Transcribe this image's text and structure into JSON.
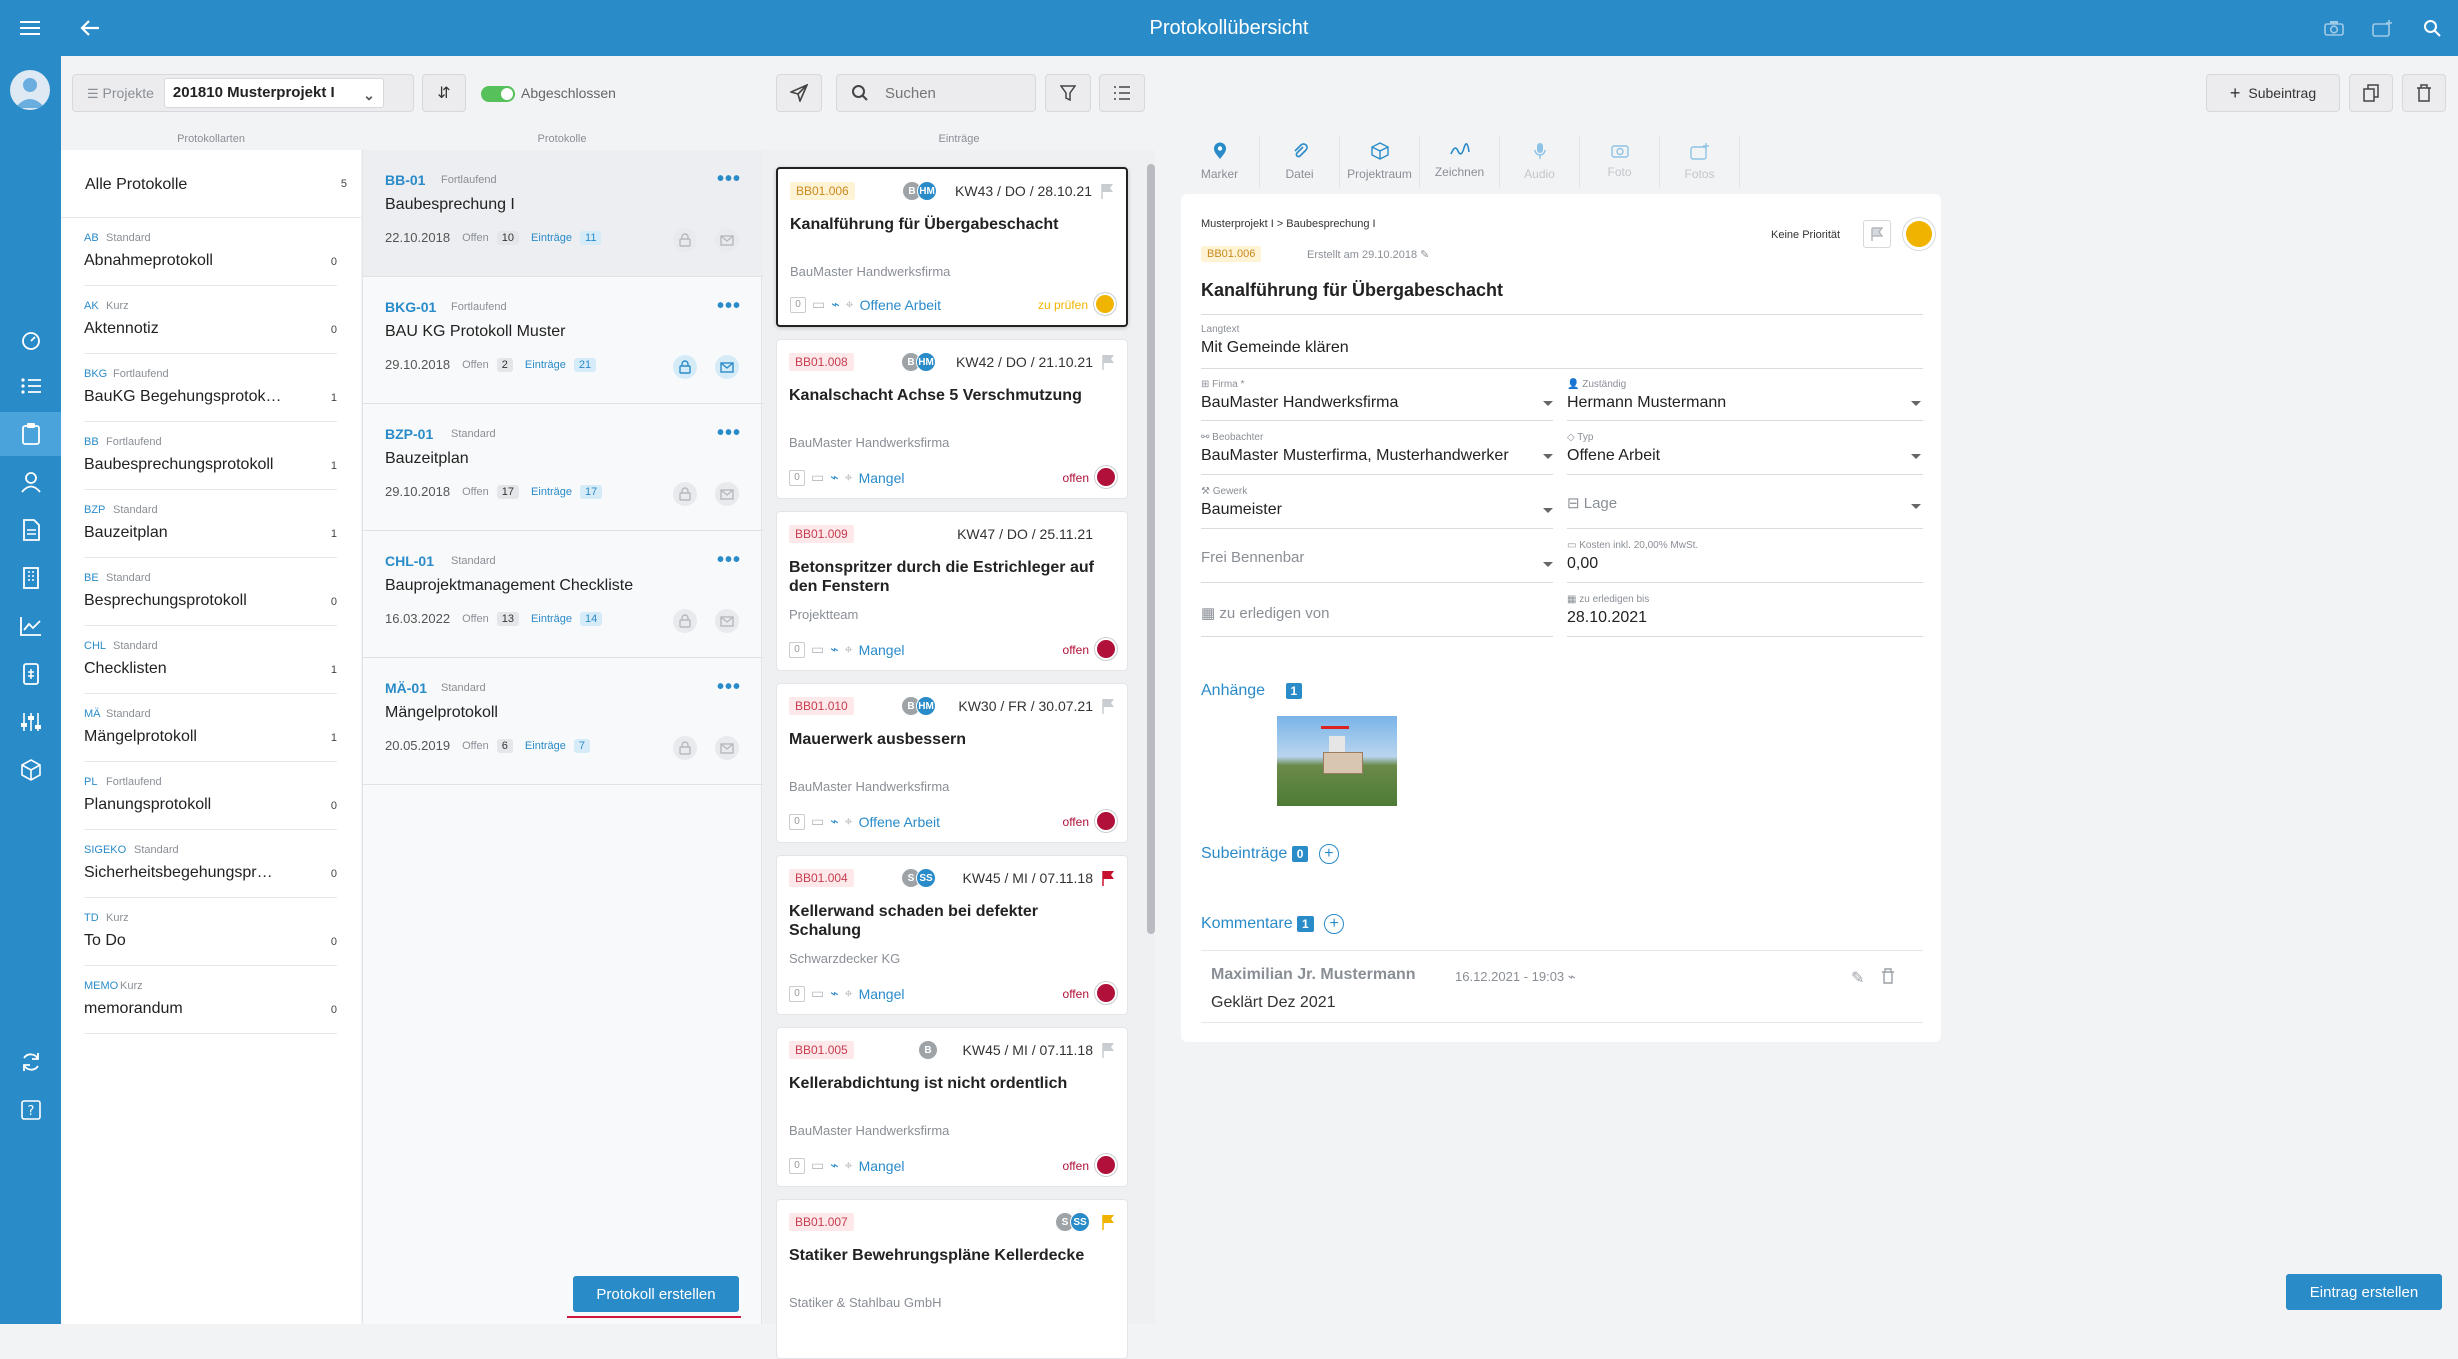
{
  "app": {
    "title": "Protokollübersicht"
  },
  "toolbar": {
    "projects_label": "Projekte",
    "project_value": "201810 Musterprojekt I",
    "toggle_label": "Abgeschlossen",
    "search_placeholder": "Suchen",
    "subentry_label": "Subeintrag"
  },
  "columns": {
    "col1": "Protokollarten",
    "col2": "Protokolle",
    "col3": "Einträge"
  },
  "categories_all": {
    "label": "Alle Protokolle",
    "count": "5"
  },
  "categories": [
    {
      "abbr": "AB",
      "type": "Standard",
      "name": "Abnahmeprotokoll",
      "count": "0"
    },
    {
      "abbr": "AK",
      "type": "Kurz",
      "name": "Aktennotiz",
      "count": "0"
    },
    {
      "abbr": "BKG",
      "type": "Fortlaufend",
      "name": "BauKG Begehungsprotok…",
      "count": "1"
    },
    {
      "abbr": "BB",
      "type": "Fortlaufend",
      "name": "Baubesprechungsprotokoll",
      "count": "1"
    },
    {
      "abbr": "BZP",
      "type": "Standard",
      "name": "Bauzeitplan",
      "count": "1"
    },
    {
      "abbr": "BE",
      "type": "Standard",
      "name": "Besprechungsprotokoll",
      "count": "0"
    },
    {
      "abbr": "CHL",
      "type": "Standard",
      "name": "Checklisten",
      "count": "1"
    },
    {
      "abbr": "MÄ",
      "type": "Standard",
      "name": "Mängelprotokoll",
      "count": "1"
    },
    {
      "abbr": "PL",
      "type": "Fortlaufend",
      "name": "Planungsprotokoll",
      "count": "0"
    },
    {
      "abbr": "SIGEKO",
      "type": "Standard",
      "name": "Sicherheitsbegehungspr…",
      "count": "0"
    },
    {
      "abbr": "TD",
      "type": "Kurz",
      "name": "To Do",
      "count": "0"
    },
    {
      "abbr": "MEMO",
      "type": "Kurz",
      "name": "memorandum",
      "count": "0"
    }
  ],
  "protocols": [
    {
      "code": "BB-01",
      "type": "Fortlaufend",
      "name": "Baubesprechung I",
      "date": "22.10.2018",
      "open_label": "Offen",
      "open": "10",
      "entries_label": "Einträge",
      "entries": "11"
    },
    {
      "code": "BKG-01",
      "type": "Fortlaufend",
      "name": "BAU KG Protokoll Muster",
      "date": "29.10.2018",
      "open_label": "Offen",
      "open": "2",
      "entries_label": "Einträge",
      "entries": "21"
    },
    {
      "code": "BZP-01",
      "type": "Standard",
      "name": "Bauzeitplan",
      "date": "29.10.2018",
      "open_label": "Offen",
      "open": "17",
      "entries_label": "Einträge",
      "entries": "17"
    },
    {
      "code": "CHL-01",
      "type": "Standard",
      "name": "Bauprojektmanagement Checkliste",
      "date": "16.03.2022",
      "open_label": "Offen",
      "open": "13",
      "entries_label": "Einträge",
      "entries": "14"
    },
    {
      "code": "MÄ-01",
      "type": "Standard",
      "name": "Mängelprotokoll",
      "date": "20.05.2019",
      "open_label": "Offen",
      "open": "6",
      "entries_label": "Einträge",
      "entries": "7"
    }
  ],
  "protocol_create_label": "Protokoll erstellen",
  "entries": [
    {
      "id": "BB01.006",
      "kw": "KW43 / DO / 28.10.21",
      "title": "Kanalführung für Übergabeschacht",
      "firm": "BauMaster Handwerksfirma",
      "type": "Offene Arbeit",
      "status": "zu prüfen",
      "status_color": "#f0b400",
      "id_style": "yellow",
      "avatars": [
        "B",
        "HM"
      ],
      "flag_color": "#c9ccd0"
    },
    {
      "id": "BB01.008",
      "kw": "KW42 / DO / 21.10.21",
      "title": "Kanalschacht Achse 5 Verschmutzung",
      "firm": "BauMaster Handwerksfirma",
      "type": "Mangel",
      "status": "offen",
      "status_color": "#b0103a",
      "id_style": "red",
      "avatars": [
        "B",
        "HM"
      ],
      "flag_color": "#c9ccd0"
    },
    {
      "id": "BB01.009",
      "kw": "KW47 / DO / 25.11.21",
      "title": "Betonspritzer durch die Estrichleger auf den Fenstern",
      "firm": "Projektteam",
      "type": "Mangel",
      "status": "offen",
      "status_color": "#b0103a",
      "id_style": "red",
      "avatars": [],
      "flag_color": ""
    },
    {
      "id": "BB01.010",
      "kw": "KW30 / FR / 30.07.21",
      "title": "Mauerwerk ausbessern",
      "firm": "BauMaster Handwerksfirma",
      "type": "Offene Arbeit",
      "status": "offen",
      "status_color": "#b0103a",
      "id_style": "red",
      "avatars": [
        "B",
        "HM"
      ],
      "flag_color": "#c9ccd0"
    },
    {
      "id": "BB01.004",
      "kw": "KW45 / MI / 07.11.18",
      "title": "Kellerwand schaden bei defekter Schalung",
      "firm": "Schwarzdecker KG",
      "type": "Mangel",
      "status": "offen",
      "status_color": "#b0103a",
      "id_style": "red",
      "avatars": [
        "S",
        "SS"
      ],
      "flag_color": "#c8102e"
    },
    {
      "id": "BB01.005",
      "kw": "KW45 / MI / 07.11.18",
      "title": "Kellerabdichtung ist nicht ordentlich",
      "firm": "BauMaster Handwerksfirma",
      "type": "Mangel",
      "status": "offen",
      "status_color": "#b0103a",
      "id_style": "red",
      "avatars": [
        "B"
      ],
      "flag_color": "#c9ccd0"
    },
    {
      "id": "BB01.007",
      "kw": "",
      "title": "Statiker Bewehrungspläne Kellerdecke",
      "firm": "Statiker & Stahlbau GmbH",
      "type": "",
      "status": "",
      "status_color": "#b0103a",
      "id_style": "red",
      "avatars": [
        "S",
        "SS"
      ],
      "flag_color": "#f0b400"
    }
  ],
  "detail_tabs": [
    {
      "label": "Marker",
      "icon": "marker-icon",
      "enabled": true
    },
    {
      "label": "Datei",
      "icon": "paperclip-icon",
      "enabled": true
    },
    {
      "label": "Projektraum",
      "icon": "cube-icon",
      "enabled": true
    },
    {
      "label": "Zeichnen",
      "icon": "draw-icon",
      "enabled": true
    },
    {
      "label": "Audio",
      "icon": "microphone-icon",
      "enabled": false
    },
    {
      "label": "Foto",
      "icon": "camera-icon",
      "enabled": false
    },
    {
      "label": "Fotos",
      "icon": "photos-icon",
      "enabled": false
    }
  ],
  "detail": {
    "breadcrumb": "Musterprojekt I > Baubesprechung I",
    "id": "BB01.006",
    "created": "Erstellt am 29.10.2018",
    "priority": "Keine Priorität",
    "title": "Kanalführung für Übergabeschacht",
    "langtext_label": "Langtext",
    "langtext": "Mit Gemeinde klären",
    "firma_label": "Firma *",
    "firma": "BauMaster Handwerksfirma",
    "zustaendig_label": "Zuständig",
    "zustaendig": "Hermann Mustermann",
    "beobachter_label": "Beobachter",
    "beobachter": "BauMaster Musterfirma, Musterhandwerker",
    "typ_label": "Typ",
    "typ": "Offene Arbeit",
    "gewerk_label": "Gewerk",
    "gewerk": "Baumeister",
    "lage_placeholder": "Lage",
    "frei_placeholder": "Frei Bennenbar",
    "kosten_label": "Kosten inkl. 20,00% MwSt.",
    "kosten": "0,00",
    "erledigen_von_placeholder": "zu erledigen von",
    "erledigen_bis_label": "zu erledigen bis",
    "erledigen_bis": "28.10.2021",
    "anhaenge_label": "Anhänge",
    "anhaenge_count": "1",
    "subeintraege_label": "Subeinträge",
    "subeintraege_count": "0",
    "kommentare_label": "Kommentare",
    "kommentare_count": "1",
    "comment_author": "Maximilian Jr. Mustermann",
    "comment_date": "16.12.2021 - 19:03",
    "comment_text": "Geklärt Dez 2021"
  },
  "entry_create_label": "Eintrag erstellen",
  "colors": {
    "accent": "#2a8bc9",
    "status_open": "#b0103a",
    "status_review": "#f0b400"
  }
}
